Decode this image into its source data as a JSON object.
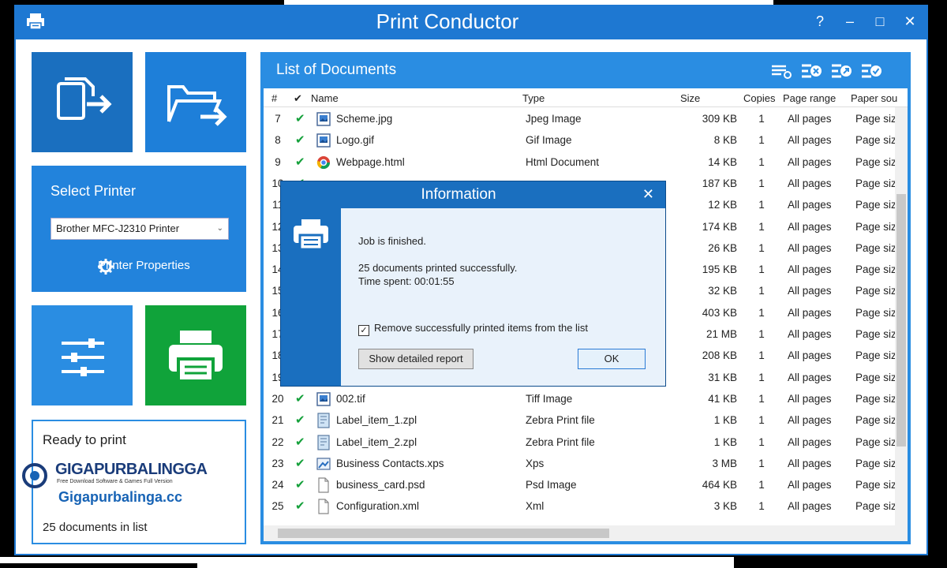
{
  "app": {
    "title": "Print Conductor"
  },
  "window_controls": {
    "help": "?",
    "minimize": "–",
    "maximize": "□",
    "close": "✕"
  },
  "left": {
    "select_printer_label": "Select Printer",
    "printer_value": "Brother MFC-J2310 Printer",
    "printer_properties": "Printer Properties",
    "status": "Ready to print",
    "docs_count": "25 documents in list"
  },
  "watermark": {
    "logo_text": "GIGAPURBALINGGA",
    "tagline": "Free Download Software & Games Full Version",
    "url": "Gigapurbalinga.cc"
  },
  "documents": {
    "title": "List of Documents",
    "columns": [
      "#",
      "✔",
      "Name",
      "Type",
      "Size",
      "Copies",
      "Page range",
      "Paper sou"
    ],
    "rows": [
      {
        "num": "7",
        "name": "Scheme.jpg",
        "type": "Jpeg Image",
        "size": "309 KB",
        "copies": "1",
        "range": "All pages",
        "paper": "Page siz",
        "icon": "image-icon"
      },
      {
        "num": "8",
        "name": "Logo.gif",
        "type": "Gif Image",
        "size": "8 KB",
        "copies": "1",
        "range": "All pages",
        "paper": "Page siz",
        "icon": "image-icon"
      },
      {
        "num": "9",
        "name": "Webpage.html",
        "type": "Html Document",
        "size": "14 KB",
        "copies": "1",
        "range": "All pages",
        "paper": "Page siz",
        "icon": "chrome-icon"
      },
      {
        "num": "10",
        "name": "",
        "type": "",
        "size": "187 KB",
        "copies": "1",
        "range": "All pages",
        "paper": "Page siz",
        "icon": ""
      },
      {
        "num": "11",
        "name": "",
        "type": "",
        "size": "12 KB",
        "copies": "1",
        "range": "All pages",
        "paper": "Page siz",
        "icon": ""
      },
      {
        "num": "12",
        "name": "",
        "type": "",
        "size": "174 KB",
        "copies": "1",
        "range": "All pages",
        "paper": "Page siz",
        "icon": ""
      },
      {
        "num": "13",
        "name": "",
        "type": "",
        "size": "26 KB",
        "copies": "1",
        "range": "All pages",
        "paper": "Page siz",
        "icon": ""
      },
      {
        "num": "14",
        "name": "",
        "type": "",
        "size": "195 KB",
        "copies": "1",
        "range": "All pages",
        "paper": "Page siz",
        "icon": ""
      },
      {
        "num": "15",
        "name": "",
        "type": "",
        "size": "32 KB",
        "copies": "1",
        "range": "All pages",
        "paper": "Page siz",
        "icon": ""
      },
      {
        "num": "16",
        "name": "",
        "type": "",
        "size": "403 KB",
        "copies": "1",
        "range": "All pages",
        "paper": "Page siz",
        "icon": ""
      },
      {
        "num": "17",
        "name": "",
        "type": "",
        "size": "21 MB",
        "copies": "1",
        "range": "All pages",
        "paper": "Page siz",
        "icon": ""
      },
      {
        "num": "18",
        "name": "",
        "type": "",
        "size": "208 KB",
        "copies": "1",
        "range": "All pages",
        "paper": "Page siz",
        "icon": ""
      },
      {
        "num": "19",
        "name": "",
        "type": "",
        "size": "31 KB",
        "copies": "1",
        "range": "All pages",
        "paper": "Page siz",
        "icon": ""
      },
      {
        "num": "20",
        "name": "002.tif",
        "type": "Tiff Image",
        "size": "41 KB",
        "copies": "1",
        "range": "All pages",
        "paper": "Page siz",
        "icon": "image-icon"
      },
      {
        "num": "21",
        "name": "Label_item_1.zpl",
        "type": "Zebra Print file",
        "size": "1 KB",
        "copies": "1",
        "range": "All pages",
        "paper": "Page siz",
        "icon": "label-icon"
      },
      {
        "num": "22",
        "name": "Label_item_2.zpl",
        "type": "Zebra Print file",
        "size": "1 KB",
        "copies": "1",
        "range": "All pages",
        "paper": "Page siz",
        "icon": "label-icon"
      },
      {
        "num": "23",
        "name": "Business Contacts.xps",
        "type": "Xps",
        "size": "3 MB",
        "copies": "1",
        "range": "All pages",
        "paper": "Page siz",
        "icon": "xps-icon"
      },
      {
        "num": "24",
        "name": "business_card.psd",
        "type": "Psd Image",
        "size": "464 KB",
        "copies": "1",
        "range": "All pages",
        "paper": "Page siz",
        "icon": "file-icon"
      },
      {
        "num": "25",
        "name": "Configuration.xml",
        "type": "Xml",
        "size": "3 KB",
        "copies": "1",
        "range": "All pages",
        "paper": "Page siz",
        "icon": "file-icon"
      }
    ]
  },
  "dialog": {
    "title": "Information",
    "close": "✕",
    "line1": "Job is finished.",
    "line2": "25 documents printed successfully.",
    "line3": "Time spent: 00:01:55",
    "checkbox_label": "Remove successfully printed items from the list",
    "checkbox_checked": true,
    "report_button": "Show detailed report",
    "ok_button": "OK"
  },
  "colors": {
    "accent": "#1e78d2",
    "print_green": "#10a33a",
    "check_green": "#14a03a"
  }
}
